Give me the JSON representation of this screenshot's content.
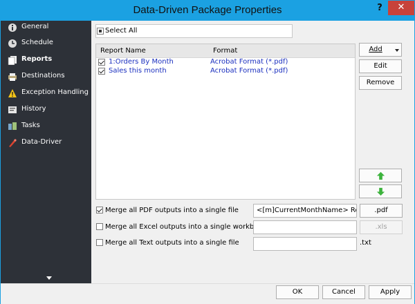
{
  "window": {
    "title": "Data-Driven Package Properties",
    "help_glyph": "?",
    "close_glyph": "✕"
  },
  "sidebar": {
    "items": [
      {
        "label": "General",
        "icon": "info-icon"
      },
      {
        "label": "Schedule",
        "icon": "clock-icon"
      },
      {
        "label": "Reports",
        "icon": "report-icon",
        "active": true
      },
      {
        "label": "Destinations",
        "icon": "printer-icon"
      },
      {
        "label": "Exception Handling",
        "icon": "warning-icon"
      },
      {
        "label": "History",
        "icon": "history-icon"
      },
      {
        "label": "Tasks",
        "icon": "tasks-icon"
      },
      {
        "label": "Data-Driver",
        "icon": "data-driver-icon"
      }
    ]
  },
  "reports": {
    "select_all_label": "Select All",
    "columns": [
      "Report Name",
      "Format"
    ],
    "rows": [
      {
        "name": "1:Orders By Month",
        "format": "Acrobat Format (*.pdf)",
        "checked": true
      },
      {
        "name": "Sales this month",
        "format": "Acrobat Format (*.pdf)",
        "checked": true
      }
    ],
    "buttons": {
      "add": "Add",
      "edit": "Edit",
      "remove": "Remove"
    }
  },
  "merge": {
    "pdf": {
      "label": "Merge all PDF outputs into a single file",
      "value": "<[m]CurrentMonthName> Reports",
      "ext": ".pdf",
      "checked": true
    },
    "excel": {
      "label": "Merge all Excel outputs into a single workbook",
      "value": "",
      "ext": ".xls",
      "checked": false
    },
    "text": {
      "label": "Merge all Text outputs into a single file",
      "value": "",
      "ext": ".txt",
      "checked": false
    }
  },
  "footer": {
    "ok": "OK",
    "cancel": "Cancel",
    "apply": "Apply"
  },
  "colors": {
    "titlebar": "#1ba1e2",
    "sidebar": "#2d3138",
    "close": "#c7423a",
    "link_blue": "#1a2fbf",
    "arrow_green": "#3db33d"
  }
}
